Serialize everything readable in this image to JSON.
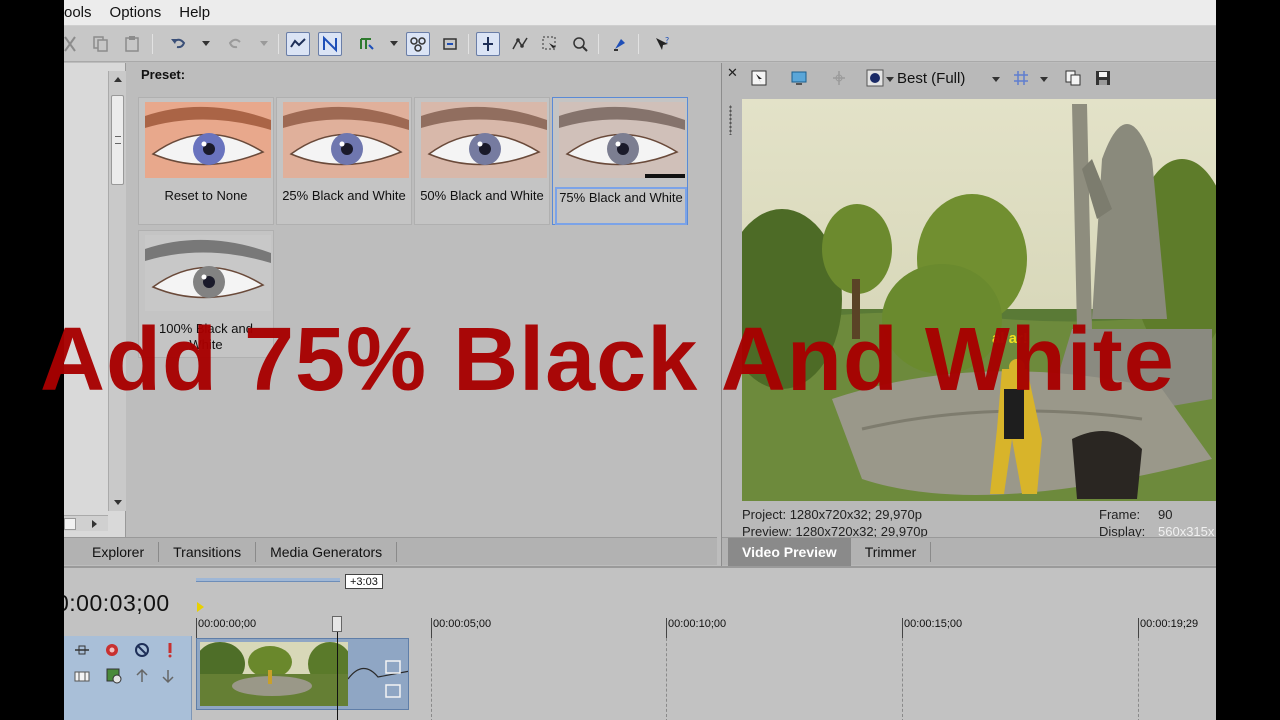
{
  "menu": {
    "items": [
      "ools",
      "Options",
      "Help"
    ]
  },
  "preset": {
    "label": "Preset:",
    "items": [
      {
        "caption": "Reset to None",
        "bw": 0
      },
      {
        "caption": "25% Black and White",
        "bw": 0.25
      },
      {
        "caption": "50% Black and White",
        "bw": 0.5
      },
      {
        "caption": "75% Black and White",
        "bw": 0.75,
        "selected": true
      },
      {
        "caption": "100% Black and White",
        "bw": 1
      }
    ]
  },
  "preview": {
    "quality": "Best (Full)",
    "project_label": "Project:",
    "project_value": "1280x720x32; 29,970p",
    "preview_label": "Preview:",
    "preview_value": "1280x720x32; 29,970p",
    "frame_label": "Frame:",
    "frame_value": "90",
    "display_label": "Display:",
    "display_value": "560x315x",
    "sign_text": "al  ar!"
  },
  "left_tabs": [
    "Explorer",
    "Transitions",
    "Media Generators"
  ],
  "right_tabs": [
    {
      "label": "Video Preview",
      "selected": true
    },
    {
      "label": "Trimmer",
      "selected": false
    }
  ],
  "timeline": {
    "timecode": "0:00:03;00",
    "cursor_badge": "+3:03",
    "ruler_labels": [
      "00:00:00;00",
      "00:00:05;00",
      "00:00:10;00",
      "00:00:15;00",
      "00:00:19;29"
    ]
  },
  "overlay": {
    "caption": "Add 75% Black And White"
  },
  "colors": {
    "overlay_red": "#a80000",
    "selection_blue": "#7ba3e8",
    "track_blue": "#a9bfd8"
  }
}
